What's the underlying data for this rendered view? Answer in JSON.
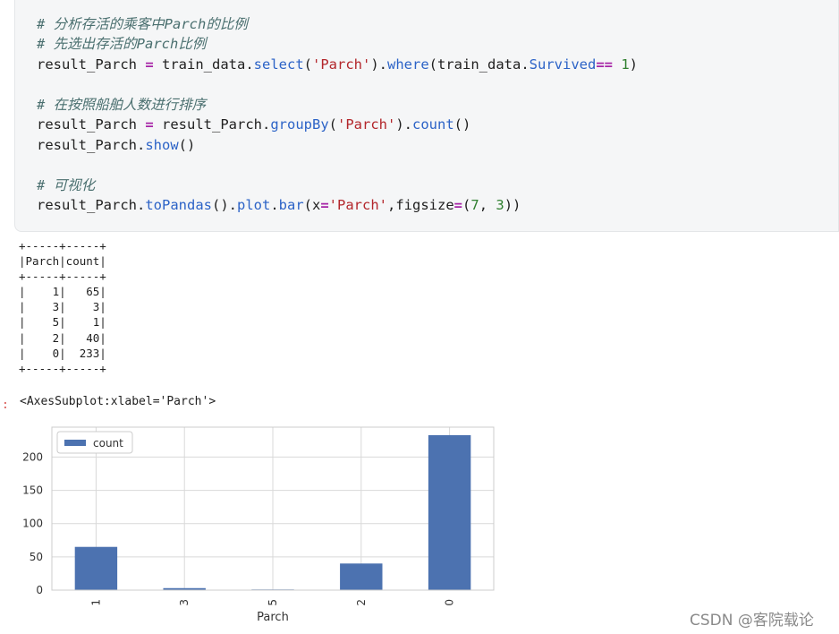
{
  "code_cell": {
    "lines": [
      {
        "segments": [
          {
            "t": "# 分析存活的乘客中Parch的比例",
            "c": "cm"
          }
        ]
      },
      {
        "segments": [
          {
            "t": "# 先选出存活的Parch比例",
            "c": "cm"
          }
        ]
      },
      {
        "segments": [
          {
            "t": "result_Parch ",
            "c": ""
          },
          {
            "t": "=",
            "c": "op"
          },
          {
            "t": " train_data.",
            "c": ""
          },
          {
            "t": "select",
            "c": "fn"
          },
          {
            "t": "(",
            "c": ""
          },
          {
            "t": "'Parch'",
            "c": "st"
          },
          {
            "t": ").",
            "c": ""
          },
          {
            "t": "where",
            "c": "fn"
          },
          {
            "t": "(train_data.",
            "c": ""
          },
          {
            "t": "Survived",
            "c": "fn"
          },
          {
            "t": "==",
            "c": "op"
          },
          {
            "t": " ",
            "c": ""
          },
          {
            "t": "1",
            "c": "nm"
          },
          {
            "t": ")",
            "c": ""
          }
        ]
      },
      {
        "segments": [
          {
            "t": "# 在按照船舶人数进行排序",
            "c": "cm"
          }
        ]
      },
      {
        "segments": [
          {
            "t": "result_Parch ",
            "c": ""
          },
          {
            "t": "=",
            "c": "op"
          },
          {
            "t": " result_Parch.",
            "c": ""
          },
          {
            "t": "groupBy",
            "c": "fn"
          },
          {
            "t": "(",
            "c": ""
          },
          {
            "t": "'Parch'",
            "c": "st"
          },
          {
            "t": ").",
            "c": ""
          },
          {
            "t": "count",
            "c": "fn"
          },
          {
            "t": "()",
            "c": ""
          }
        ]
      },
      {
        "segments": [
          {
            "t": "result_Parch.",
            "c": ""
          },
          {
            "t": "show",
            "c": "fn"
          },
          {
            "t": "()",
            "c": ""
          }
        ]
      },
      {
        "segments": [
          {
            "t": "# 可视化",
            "c": "cm"
          }
        ]
      },
      {
        "segments": [
          {
            "t": "result_Parch.",
            "c": ""
          },
          {
            "t": "toPandas",
            "c": "fn"
          },
          {
            "t": "().",
            "c": ""
          },
          {
            "t": "plot",
            "c": "fn"
          },
          {
            "t": ".",
            "c": ""
          },
          {
            "t": "bar",
            "c": "fn"
          },
          {
            "t": "(x",
            "c": ""
          },
          {
            "t": "=",
            "c": "op"
          },
          {
            "t": "'Parch'",
            "c": "st"
          },
          {
            "t": ",figsize",
            "c": ""
          },
          {
            "t": "=",
            "c": "op"
          },
          {
            "t": "(",
            "c": ""
          },
          {
            "t": "7",
            "c": "nm"
          },
          {
            "t": ", ",
            "c": ""
          },
          {
            "t": "3",
            "c": "nm"
          },
          {
            "t": "))",
            "c": ""
          }
        ]
      }
    ]
  },
  "output_table": "+-----+-----+\n|Parch|count|\n+-----+-----+\n|    1|   65|\n|    3|    3|\n|    5|    1|\n|    2|   40|\n|    0|  233|\n+-----+-----+",
  "output_prompt": ":",
  "repr_text": "<AxesSubplot:xlabel='Parch'>",
  "chart_data": {
    "type": "bar",
    "categories": [
      "1",
      "3",
      "5",
      "2",
      "0"
    ],
    "series": [
      {
        "name": "count",
        "values": [
          65,
          3,
          1,
          40,
          233
        ],
        "color": "#4c72b0"
      }
    ],
    "xlabel": "Parch",
    "ylabel": "",
    "ylim": [
      0,
      245
    ],
    "yticks": [
      "0",
      "50",
      "100",
      "150",
      "200"
    ],
    "grid": true,
    "legend": "top-left"
  },
  "watermark": "CSDN @客院载论"
}
